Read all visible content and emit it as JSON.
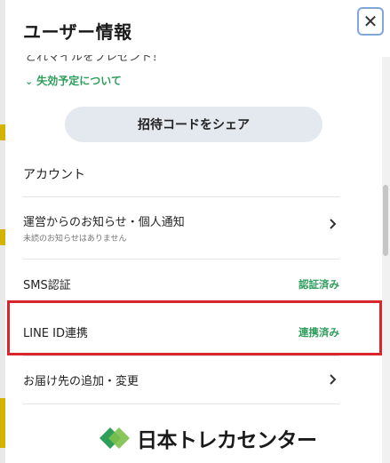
{
  "header": {
    "title": "ユーザー情報",
    "close_label": "✕"
  },
  "scroll_partial_text": "とれマイルをプレゼント！",
  "expire_link": {
    "label": "失効予定について"
  },
  "invite_button": {
    "label": "招待コードをシェア"
  },
  "account": {
    "section_title": "アカウント",
    "rows": [
      {
        "label": "運営からのお知らせ・個人通知",
        "sub": "未読のお知らせはありません",
        "chevron": "›"
      },
      {
        "label": "SMS認証",
        "status": "認証済み"
      },
      {
        "label": "LINE ID連携",
        "status": "連携済み"
      },
      {
        "label": "お届け先の追加・変更",
        "chevron": "›"
      }
    ]
  },
  "logo": {
    "text": "日本トレカセンター"
  },
  "colors": {
    "accent_green": "#2e9e5b",
    "highlight_red": "#d9262d",
    "button_bg": "#e4e9f0"
  }
}
